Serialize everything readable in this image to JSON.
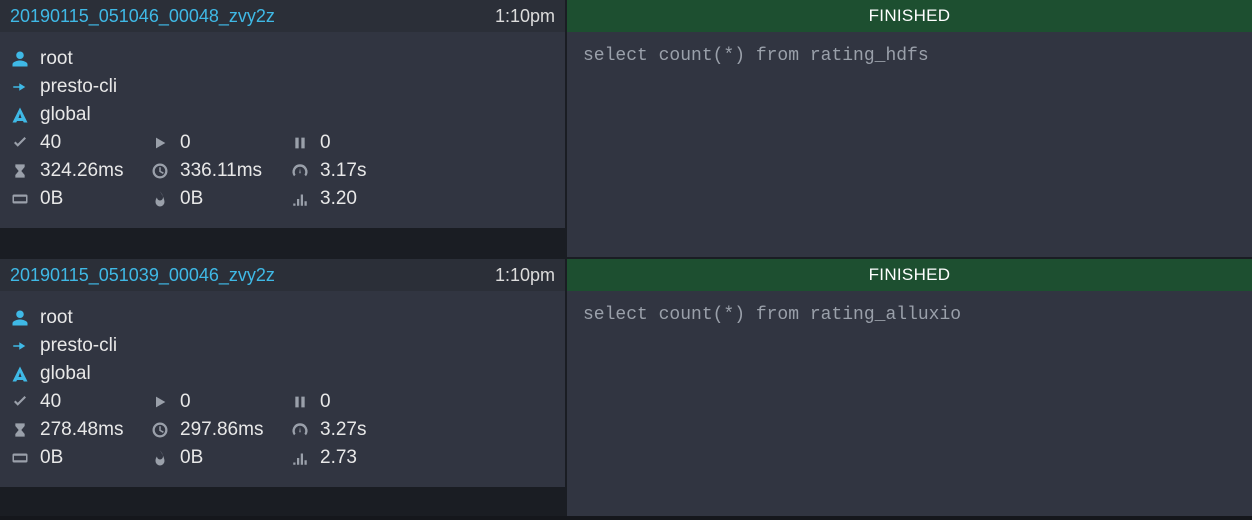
{
  "queries": [
    {
      "id": "20190115_051046_00048_zvy2z",
      "time": "1:10pm",
      "status": "FINISHED",
      "user": "root",
      "source": "presto-cli",
      "resource": "global",
      "completed": "40",
      "running": "0",
      "queued": "0",
      "cpu": "324.26ms",
      "wall": "336.11ms",
      "elapsed": "3.17s",
      "input": "0B",
      "peakmem": "0B",
      "parallelism": "3.20",
      "sql": "select count(*) from rating_hdfs"
    },
    {
      "id": "20190115_051039_00046_zvy2z",
      "time": "1:10pm",
      "status": "FINISHED",
      "user": "root",
      "source": "presto-cli",
      "resource": "global",
      "completed": "40",
      "running": "0",
      "queued": "0",
      "cpu": "278.48ms",
      "wall": "297.86ms",
      "elapsed": "3.27s",
      "input": "0B",
      "peakmem": "0B",
      "parallelism": "2.73",
      "sql": "select count(*) from rating_alluxio"
    }
  ]
}
